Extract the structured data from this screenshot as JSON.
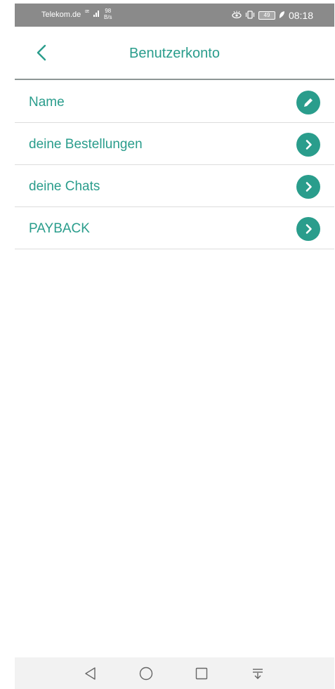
{
  "status_bar": {
    "carrier": "Telekom.de",
    "network_type": "LTE",
    "speed_value": "98",
    "speed_unit": "B/s",
    "battery_level": "49",
    "time": "08:18"
  },
  "header": {
    "title": "Benutzerkonto"
  },
  "account_menu": {
    "items": [
      {
        "label": "Name",
        "icon": "pencil-icon"
      },
      {
        "label": "deine Bestellungen",
        "icon": "chevron-right-icon"
      },
      {
        "label": "deine Chats",
        "icon": "chevron-right-icon"
      },
      {
        "label": "PAYBACK",
        "icon": "chevron-right-icon"
      }
    ]
  },
  "navigation_bar": {
    "buttons": [
      "back-triangle-icon",
      "home-circle-icon",
      "recents-square-icon",
      "notification-drawer-icon"
    ]
  },
  "colors": {
    "accent": "#2a9d8c",
    "status_bar": "#8a8a8a",
    "divider": "#dcdcdc",
    "header_divider": "#8e9695",
    "nav_bar": "#f2f2f2"
  }
}
